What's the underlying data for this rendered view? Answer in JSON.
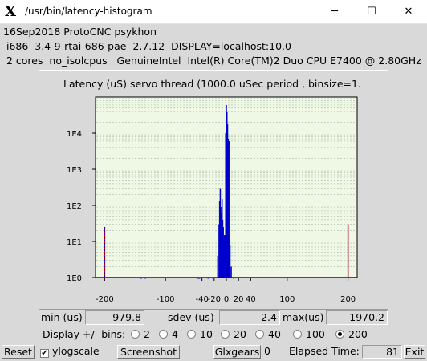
{
  "window": {
    "title": "/usr/bin/latency-histogram",
    "app_icon": "X",
    "minimize_icon": "─",
    "maximize_icon": "☐",
    "close_icon": "✕"
  },
  "info": {
    "line1": "16Sep2018 ProtoCNC psykhon",
    "line2": " i686  3.4-9-rtai-686-pae  2.7.12  DISPLAY=localhost:10.0",
    "line3": " 2 cores  no_isolcpus   GenuineIntel  Intel(R) Core(TM)2 Duo CPU E7400 @ 2.80GHz"
  },
  "chart_data": {
    "type": "bar",
    "title": "Latency (uS) servo thread (1000.0 uSec period , binsize=1.",
    "xlabel": "",
    "ylabel": "",
    "xlim": [
      -215,
      215
    ],
    "ylim": [
      1,
      100000
    ],
    "yscale": "log",
    "x_tick_labels": [
      "-200",
      "-100",
      "-40",
      "-20",
      "0",
      "20",
      "40",
      "100",
      "200"
    ],
    "x_ticks": [
      -200,
      -100,
      -40,
      -20,
      0,
      20,
      40,
      100,
      200
    ],
    "y_tick_labels": [
      "1E0",
      "1E1",
      "1E2",
      "1E3",
      "1E4"
    ],
    "y_ticks": [
      1,
      10,
      100,
      1000,
      10000
    ],
    "grid": true,
    "bar_color": "#0000cc",
    "outlier_color": "#cc0000",
    "x": [
      -200,
      -140,
      -133,
      -48,
      -46,
      -44,
      -30,
      -22,
      -14,
      -12,
      -11,
      -10,
      -9,
      -8,
      -7,
      -6,
      -5,
      -4,
      -3,
      -2,
      -1,
      0,
      1,
      2,
      3,
      4,
      5,
      6,
      8,
      12,
      200
    ],
    "values": [
      25,
      1,
      1,
      1,
      1,
      1,
      1,
      1,
      4,
      30,
      130,
      300,
      60,
      90,
      150,
      40,
      25,
      12,
      15,
      6,
      10000,
      60000,
      40000,
      18000,
      7000,
      12,
      6000,
      8,
      2,
      1,
      30
    ]
  },
  "stats": {
    "min_label": "min (us)",
    "min_value": "-979.8",
    "sdev_label": "sdev (us)",
    "sdev_value": "2.4",
    "max_label": "max(us)",
    "max_value": "1970.2"
  },
  "bins": {
    "label": "Display +/- bins:",
    "options": [
      "2",
      "4",
      "10",
      "20",
      "40",
      "100",
      "200"
    ],
    "selected": "200"
  },
  "bottom": {
    "reset": "Reset",
    "ylogscale": "ylogscale",
    "ylogscale_checked": true,
    "screenshot": "Screenshot",
    "glxgears": "Glxgears",
    "glxgears_count": "0",
    "elapsed_label": "Elapsed Time:",
    "elapsed_value": "81",
    "exit": "Exit"
  }
}
